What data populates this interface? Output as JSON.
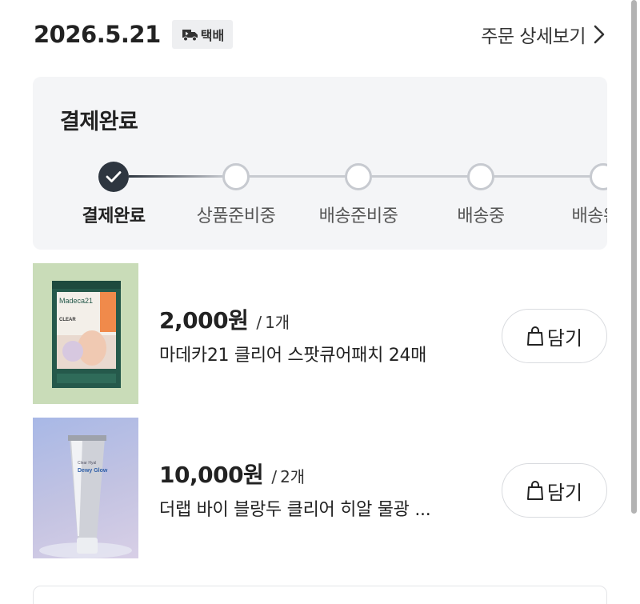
{
  "order": {
    "date": "2026.5.21",
    "delivery_type": "택배",
    "detail_link": "주문 상세보기"
  },
  "status": {
    "title": "결제완료",
    "current_step": 0,
    "steps": [
      "결제완료",
      "상품준비중",
      "배송준비중",
      "배송중",
      "배송완료"
    ]
  },
  "products": [
    {
      "price": "2,000원",
      "separator": "/",
      "quantity": "1개",
      "name": "마데카21 클리어 스팟큐어패치 24매",
      "cart_label": "담기",
      "thumb_text": {
        "brand": "Madeca21",
        "line": "CLEAR"
      }
    },
    {
      "price": "10,000원",
      "separator": "/",
      "quantity": "2개",
      "name": "더랩 바이 블랑두 클리어 히알 물광 ...",
      "cart_label": "담기",
      "thumb_text": {
        "brand": "Dewy Glow",
        "line": "Clear Hyal"
      }
    }
  ],
  "colors": {
    "step_done": "#2e3640",
    "step_todo": "#c7cad0",
    "card_bg": "#f4f5f7",
    "product1_bg": "#c9dcb8",
    "product2_bg": "#b9c2df"
  }
}
